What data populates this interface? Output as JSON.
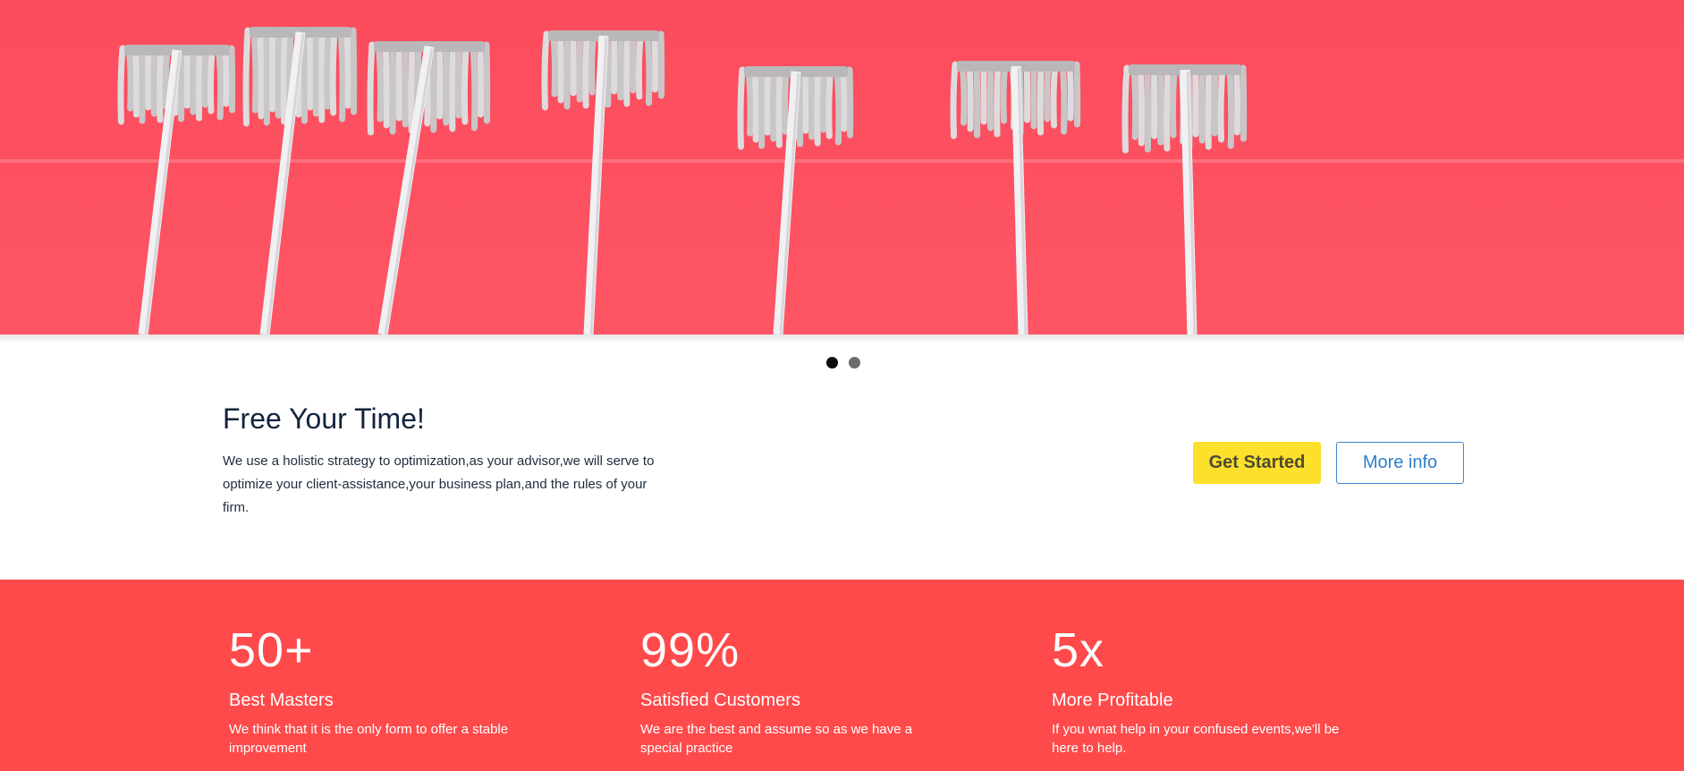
{
  "hero": {
    "background_color": "#fe5565",
    "image_subject": "mops-on-red-wall"
  },
  "slider": {
    "slide_count": 2,
    "active_index": 0
  },
  "intro": {
    "title": "Free Your Time!",
    "text": "We use a holistic strategy to optimization,as your advisor,we will serve to optimize your client-assistance,your business plan,and the rules of your firm.",
    "primary_button": "Get Started",
    "secondary_button": "More info"
  },
  "stats": {
    "background_color": "#fe4a4b",
    "items": [
      {
        "number": "50+",
        "title": "Best Masters",
        "text": "We think that it is the only form to offer a stable improvement"
      },
      {
        "number": "99%",
        "title": "Satisfied Customers",
        "text": "We are the best and assume so as we have a special practice"
      },
      {
        "number": "5x",
        "title": "More Profitable",
        "text": "If you wnat help in your confused events,we'll be here to help."
      }
    ]
  },
  "colors": {
    "accent_yellow": "#fde02b",
    "link_blue": "#2c7fc9",
    "heading_navy": "#13243d"
  }
}
